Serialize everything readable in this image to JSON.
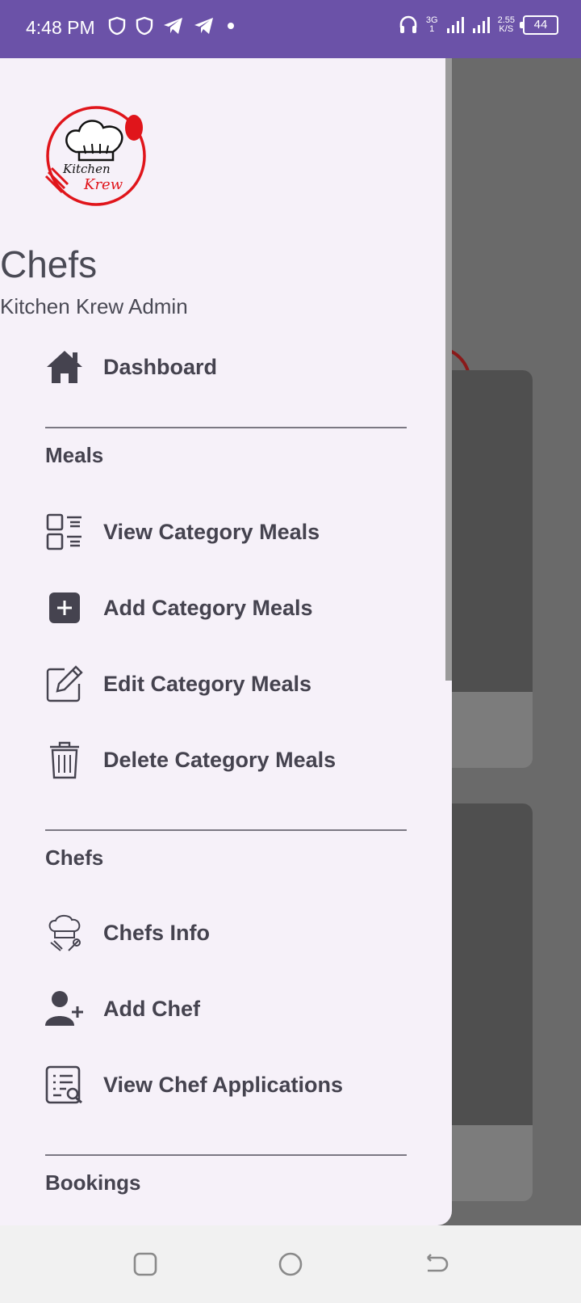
{
  "status": {
    "time": "4:48 PM",
    "network_top": "3G",
    "network_bottom": "1",
    "speed_top": "2.55",
    "speed_bottom": "K/S",
    "battery": "44"
  },
  "drawer": {
    "logo_text_1": "Kitchen",
    "logo_text_2": "Krew",
    "title": "Chefs",
    "subtitle": "Kitchen Krew Admin",
    "dashboard": "Dashboard",
    "sections": {
      "meals": "Meals",
      "chefs": "Chefs",
      "bookings": "Bookings"
    },
    "meals_items": [
      {
        "label": "View Category Meals",
        "icon": "view-list-icon"
      },
      {
        "label": "Add Category Meals",
        "icon": "add-box-icon"
      },
      {
        "label": "Edit Category Meals",
        "icon": "edit-icon"
      },
      {
        "label": "Delete Category Meals",
        "icon": "trash-icon"
      }
    ],
    "chefs_items": [
      {
        "label": "Chefs Info",
        "icon": "chef-hat-icon"
      },
      {
        "label": "Add Chef",
        "icon": "add-person-icon"
      },
      {
        "label": "View Chef Applications",
        "icon": "applications-search-icon"
      }
    ]
  },
  "colors": {
    "status_bar": "#6b52a8",
    "drawer_bg": "#f6f1f9",
    "text": "#45434f",
    "logo_red": "#e0151b"
  }
}
